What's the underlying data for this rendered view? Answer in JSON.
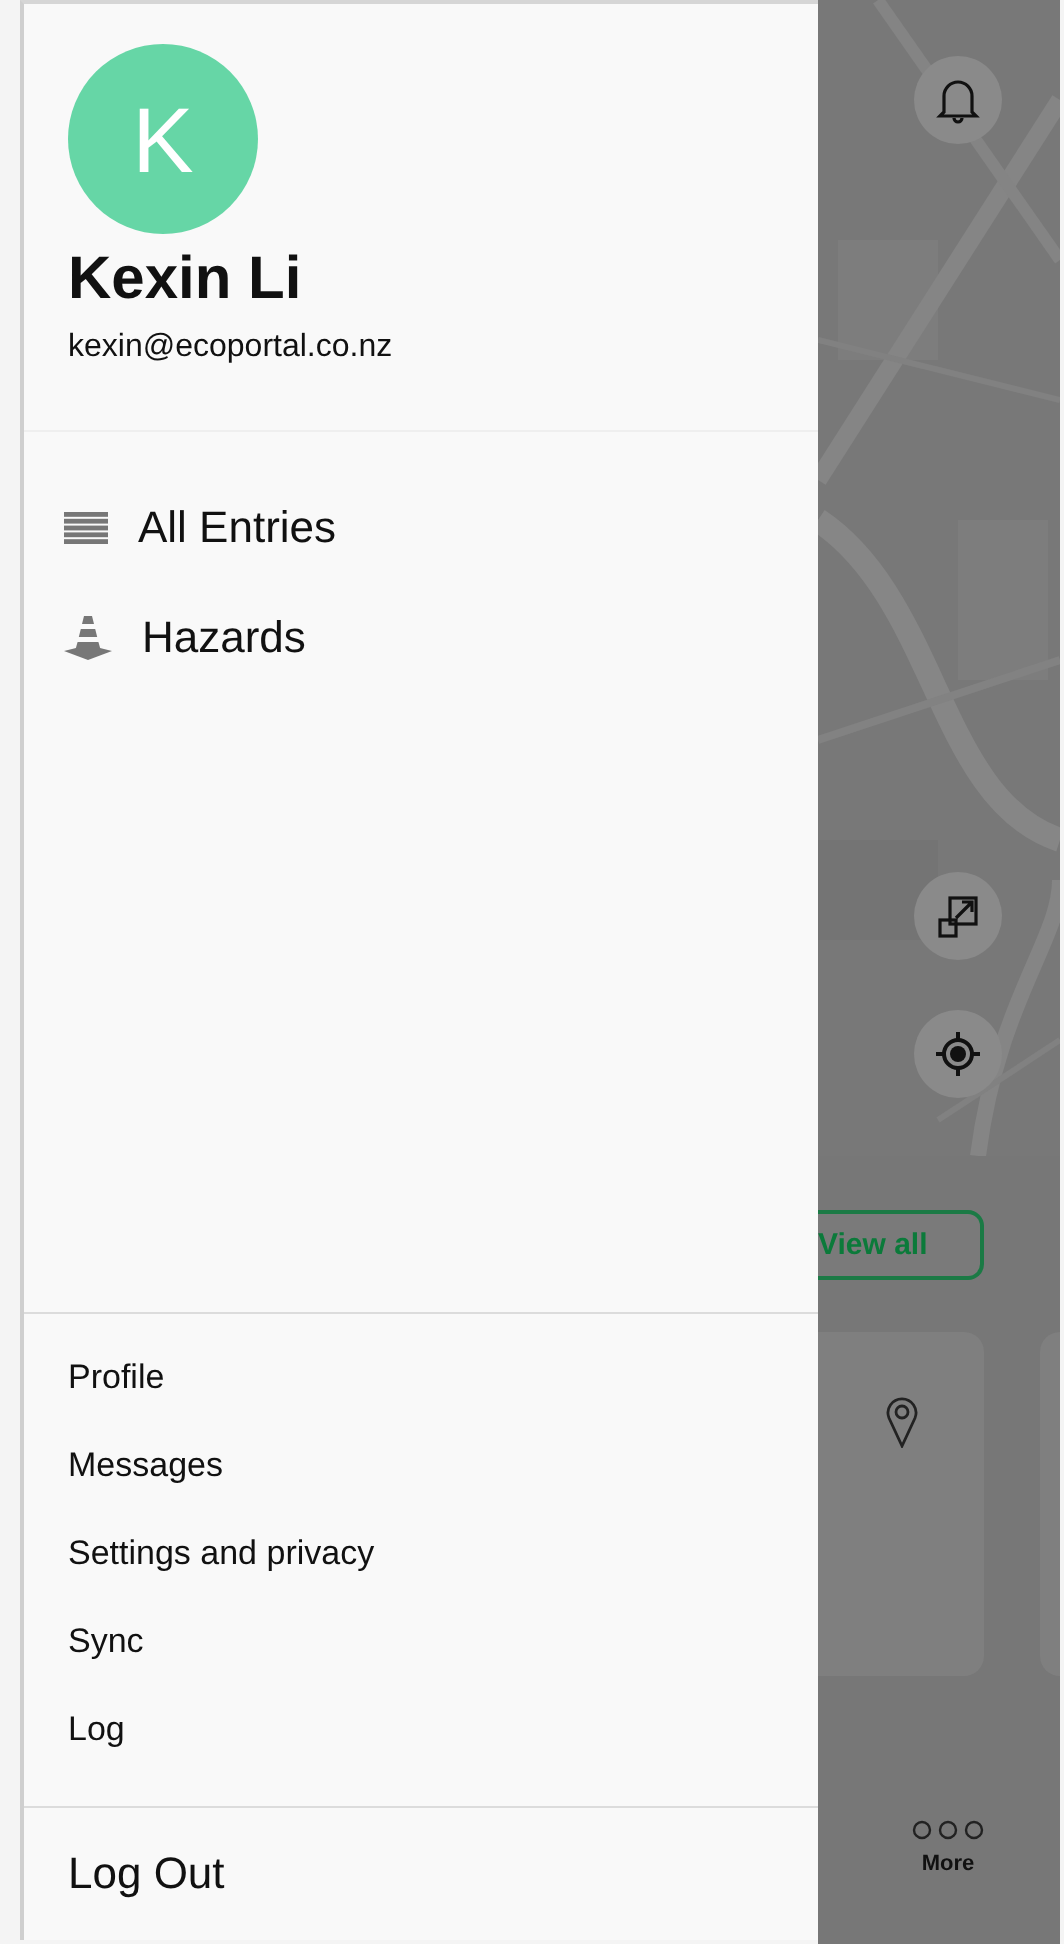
{
  "drawer": {
    "user": {
      "initial": "K",
      "name": "Kexin Li",
      "email": "kexin@ecoportal.co.nz"
    },
    "nav_items": [
      {
        "label": "All Entries",
        "kind": "list"
      },
      {
        "label": "Hazards",
        "kind": "cone"
      }
    ],
    "secondary_items": [
      "Profile",
      "Messages",
      "Settings and privacy",
      "Sync",
      "Log"
    ],
    "logout": "Log Out"
  },
  "background": {
    "view_all": "View all",
    "bottom_nav": {
      "label": "More"
    }
  }
}
